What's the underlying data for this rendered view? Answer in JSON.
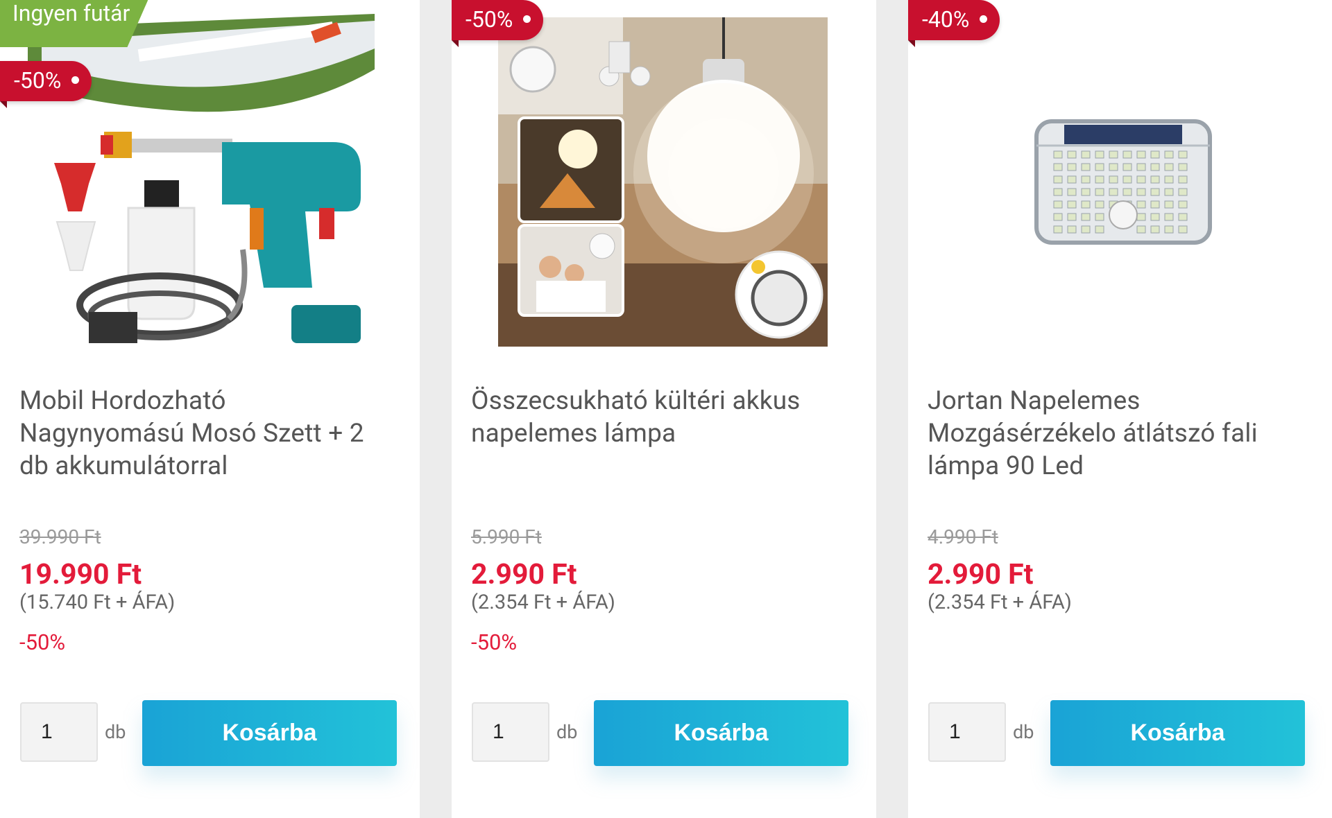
{
  "products": [
    {
      "free_shipping_badge": "Ingyen futár",
      "discount_badge": "-50%",
      "image_icon": "pressure-washer-icon",
      "title_lines": [
        "Mobil Hordozható",
        "Nagynyomású Mosó Szett + 2",
        "db akkumulátorral"
      ],
      "old_price": "39.990 Ft",
      "new_price": "19.990 Ft",
      "net_price": "(15.740 Ft + ÁFA)",
      "discount_text": "-50%",
      "quantity": "1",
      "unit": "db",
      "cart_label": "Kosárba"
    },
    {
      "discount_badge": "-50%",
      "image_icon": "solar-lamp-icon",
      "title_lines": [
        "Összecsukható kültéri akkus",
        "napelemes lámpa"
      ],
      "old_price": "5.990 Ft",
      "new_price": "2.990 Ft",
      "net_price": "(2.354 Ft + ÁFA)",
      "discount_text": "-50%",
      "quantity": "1",
      "unit": "db",
      "cart_label": "Kosárba"
    },
    {
      "discount_badge": "-40%",
      "image_icon": "wall-lamp-icon",
      "title_lines": [
        "Jortan Napelemes",
        "Mozgásérzékelo átlátszó fali",
        "lámpa 90 Led"
      ],
      "old_price": "4.990 Ft",
      "new_price": "2.990 Ft",
      "net_price": "(2.354 Ft + ÁFA)",
      "discount_text": "",
      "quantity": "1",
      "unit": "db",
      "cart_label": "Kosárba"
    }
  ],
  "colors": {
    "badge_red": "#c8102e",
    "price_red": "#e31b3a",
    "free_shipping_green": "#7cb342",
    "button_gradient_start": "#1aa3d6",
    "button_gradient_end": "#22c2d8"
  }
}
